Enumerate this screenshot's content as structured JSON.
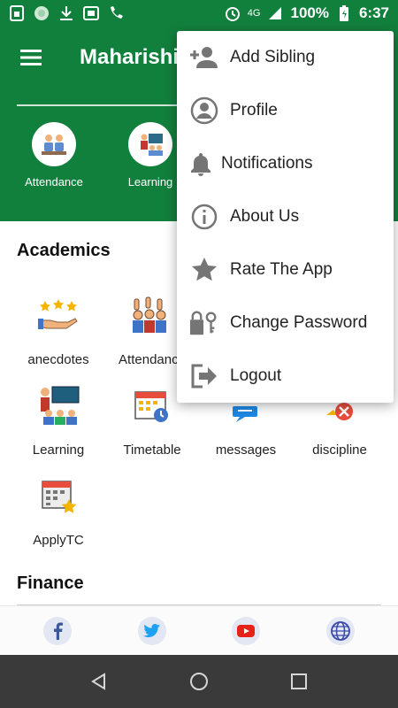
{
  "status_bar": {
    "network": "4G",
    "battery": "100%",
    "time": "6:37",
    "icons": [
      "sim-icon",
      "circle-app-icon",
      "download-icon",
      "screenshot-icon",
      "phone-icon",
      "alarm-icon",
      "signal-icon",
      "battery-charging-icon"
    ]
  },
  "app_bar": {
    "title": "Maharishi"
  },
  "quick_actions": [
    {
      "label": "Attendance",
      "icon": "attendance-icon"
    },
    {
      "label": "Learning",
      "icon": "learning-icon"
    }
  ],
  "academics": {
    "title": "Academics",
    "items": [
      {
        "label": "anecdotes",
        "icon": "anecdotes-icon"
      },
      {
        "label": "Attendance",
        "icon": "attendance-icon"
      },
      {
        "label": "",
        "icon": "hidden-icon"
      },
      {
        "label": "",
        "icon": "hidden-icon"
      },
      {
        "label": "Learning",
        "icon": "learning-icon"
      },
      {
        "label": "Timetable",
        "icon": "timetable-icon"
      },
      {
        "label": "messages",
        "icon": "messages-icon"
      },
      {
        "label": "discipline",
        "icon": "discipline-icon"
      },
      {
        "label": "ApplyTC",
        "icon": "apply-tc-icon"
      }
    ]
  },
  "finance": {
    "title": "Finance"
  },
  "social": [
    {
      "name": "facebook",
      "icon": "facebook-icon"
    },
    {
      "name": "twitter",
      "icon": "twitter-icon"
    },
    {
      "name": "youtube",
      "icon": "youtube-icon"
    },
    {
      "name": "website",
      "icon": "globe-icon"
    }
  ],
  "menu": {
    "items": [
      {
        "label": "Add Sibling",
        "icon": "add-person-icon"
      },
      {
        "label": "Profile",
        "icon": "profile-icon"
      },
      {
        "label": "Notifications",
        "icon": "bell-icon"
      },
      {
        "label": "About Us",
        "icon": "info-icon"
      },
      {
        "label": "Rate The App",
        "icon": "star-icon"
      },
      {
        "label": "Change Password",
        "icon": "lock-icon"
      },
      {
        "label": "Logout",
        "icon": "logout-icon"
      }
    ]
  },
  "colors": {
    "primary": "#12803d",
    "menu_icon": "#757575",
    "nav_bar": "#3a3a3a"
  }
}
